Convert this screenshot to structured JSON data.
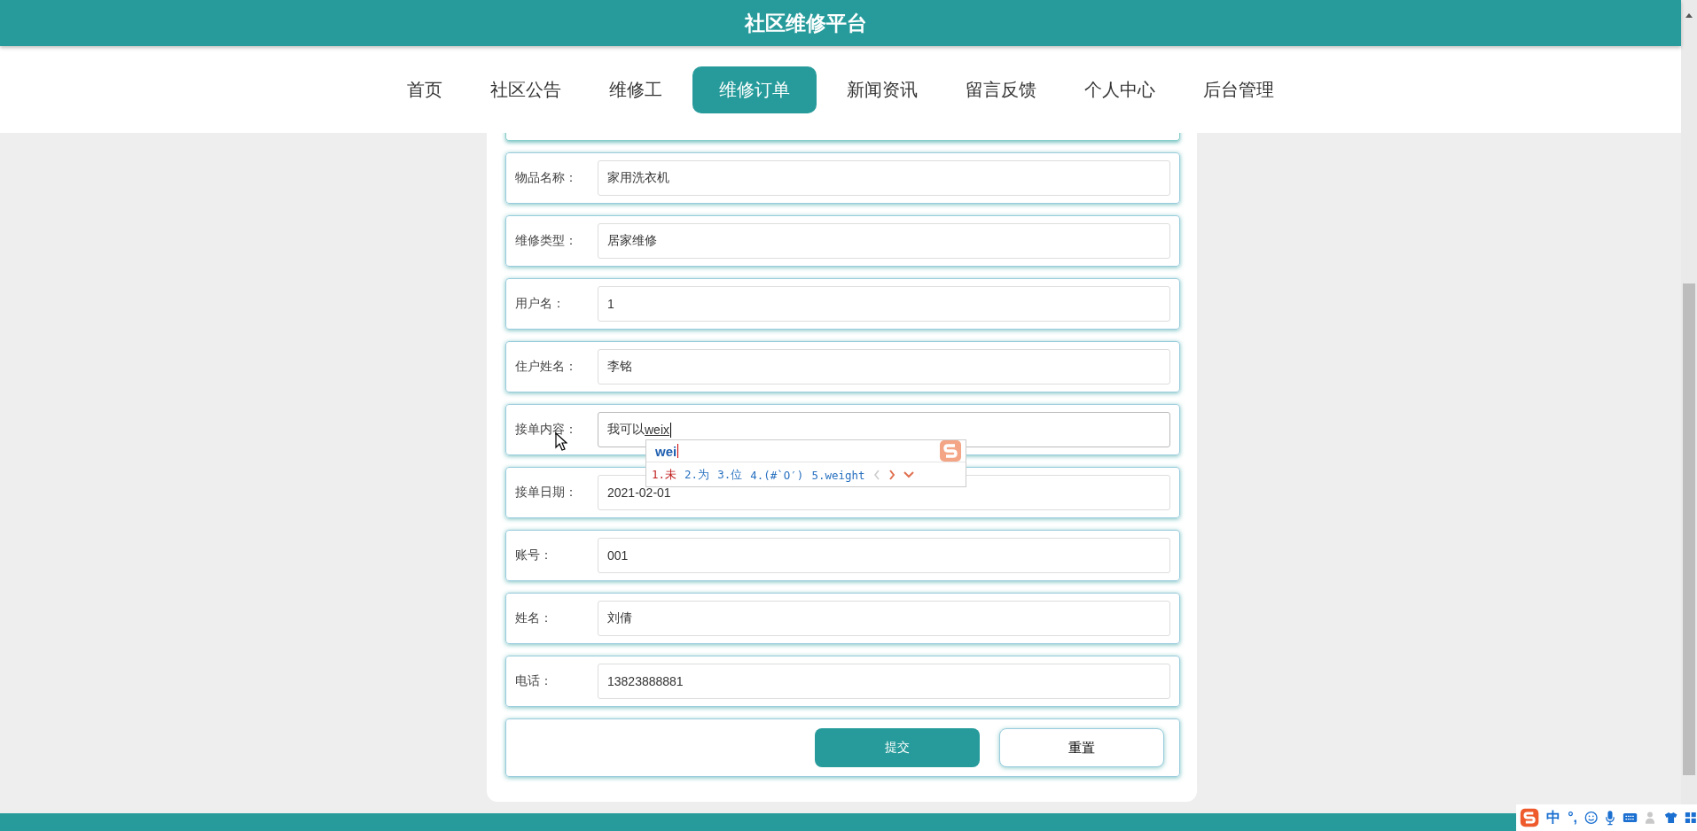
{
  "header": {
    "title": "社区维修平台"
  },
  "nav": [
    {
      "label": "首页",
      "selected": false
    },
    {
      "label": "社区公告",
      "selected": false
    },
    {
      "label": "维修工",
      "selected": false
    },
    {
      "label": "维修订单",
      "selected": true
    },
    {
      "label": "新闻资讯",
      "selected": false
    },
    {
      "label": "留言反馈",
      "selected": false
    },
    {
      "label": "个人中心",
      "selected": false
    },
    {
      "label": "后台管理",
      "selected": false
    }
  ],
  "form": {
    "fields": [
      {
        "label": "物品名称：",
        "value": "家用洗衣机"
      },
      {
        "label": "维修类型：",
        "value": "居家维修"
      },
      {
        "label": "用户名：",
        "value": "1"
      },
      {
        "label": "住户姓名：",
        "value": "李铭"
      },
      {
        "label": "接单内容：",
        "value": "我可以",
        "composing": "weix",
        "focused": true
      },
      {
        "label": "接单日期：",
        "value": "2021-02-01"
      },
      {
        "label": "账号：",
        "value": "001"
      },
      {
        "label": "姓名：",
        "value": "刘倩"
      },
      {
        "label": "电话：",
        "value": "13823888881"
      }
    ],
    "buttons": [
      {
        "label": "提交",
        "kind": "primary"
      },
      {
        "label": "重置",
        "kind": "secondary"
      }
    ]
  },
  "ime_popup": {
    "input": "wei",
    "candidates": [
      {
        "label": "1.未",
        "selected": true
      },
      {
        "label": "2.为",
        "selected": false
      },
      {
        "label": "3.位",
        "selected": false
      },
      {
        "label": "4.(#`O′)",
        "selected": false
      },
      {
        "label": "5.weight",
        "selected": false
      }
    ]
  },
  "ime_toolbar": {
    "mode": "中",
    "punctuation": "°,"
  }
}
